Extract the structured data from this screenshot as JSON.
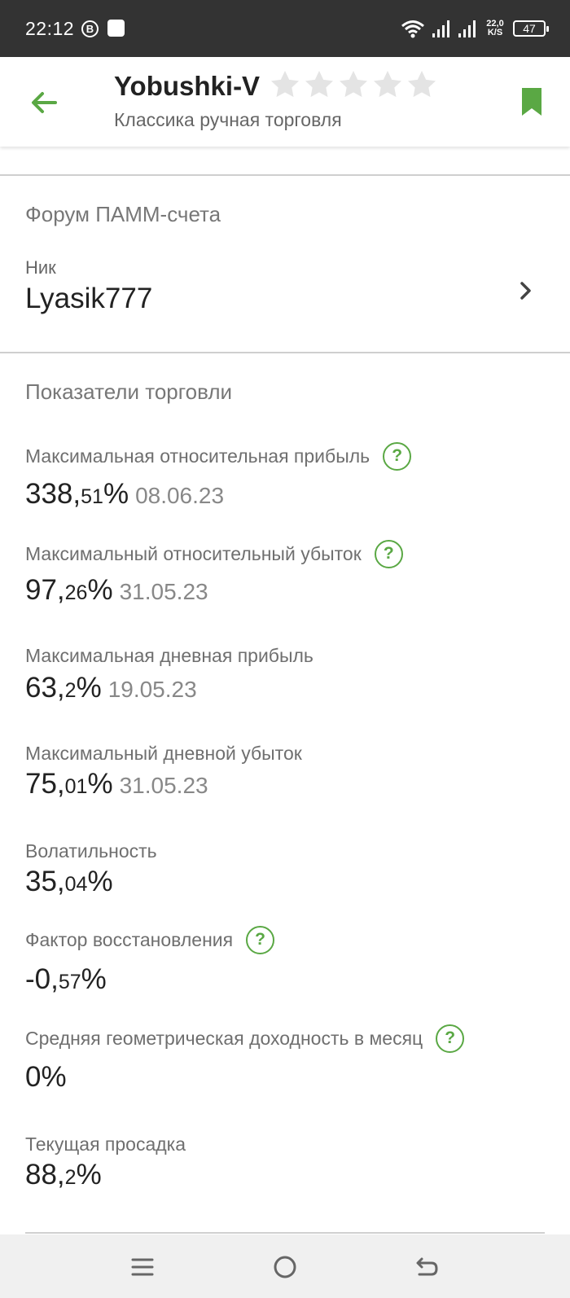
{
  "status_bar": {
    "time": "22:12",
    "b_badge": "B",
    "speed_value": "22,0",
    "speed_unit": "K/S",
    "battery": "47"
  },
  "header": {
    "title": "Yobushki-V",
    "subtitle": "Классика ручная торговля",
    "stars_filled": 0,
    "stars_total": 5
  },
  "forum": {
    "section_title": "Форум ПАММ-счета",
    "nick_label": "Ник",
    "nick_value": "Lyasik777"
  },
  "trading": {
    "section_title": "Показатели торговли",
    "metrics": [
      {
        "label": "Максимальная относительная прибыль",
        "int": "338,",
        "dec": "51",
        "unit": "%",
        "date": "08.06.23",
        "help": "?"
      },
      {
        "label": "Максимальный относительный убыток",
        "int": "97,",
        "dec": "26",
        "unit": "%",
        "date": "31.05.23",
        "help": "?"
      },
      {
        "label": "Максимальная дневная прибыль",
        "int": "63,",
        "dec": "2",
        "unit": "%",
        "date": "19.05.23"
      },
      {
        "label": "Максимальный дневной убыток",
        "int": "75,",
        "dec": "01",
        "unit": "%",
        "date": "31.05.23"
      },
      {
        "label": "Волатильность",
        "int": "35,",
        "dec": "04",
        "unit": "%"
      },
      {
        "label": "Фактор восстановления",
        "int": "-0,",
        "dec": "57",
        "unit": "%",
        "help": "?"
      },
      {
        "label": "Средняя геометрическая доходность в месяц",
        "int": "0",
        "dec": "",
        "unit": "%",
        "help": "?"
      },
      {
        "label": "Текущая просадка",
        "int": "88,",
        "dec": "2",
        "unit": "%"
      }
    ]
  },
  "colors": {
    "accent": "#5aa844",
    "status_bar": "#333333",
    "nav_bar": "#f0f0f0"
  },
  "icons": {
    "back": "arrow-left-icon",
    "bookmark": "bookmark-icon",
    "chevron": "chevron-right-icon",
    "help": "help-circle-icon",
    "star": "star-icon",
    "nav_menu": "menu-icon",
    "nav_home": "home-circle-icon",
    "nav_back": "back-icon"
  }
}
